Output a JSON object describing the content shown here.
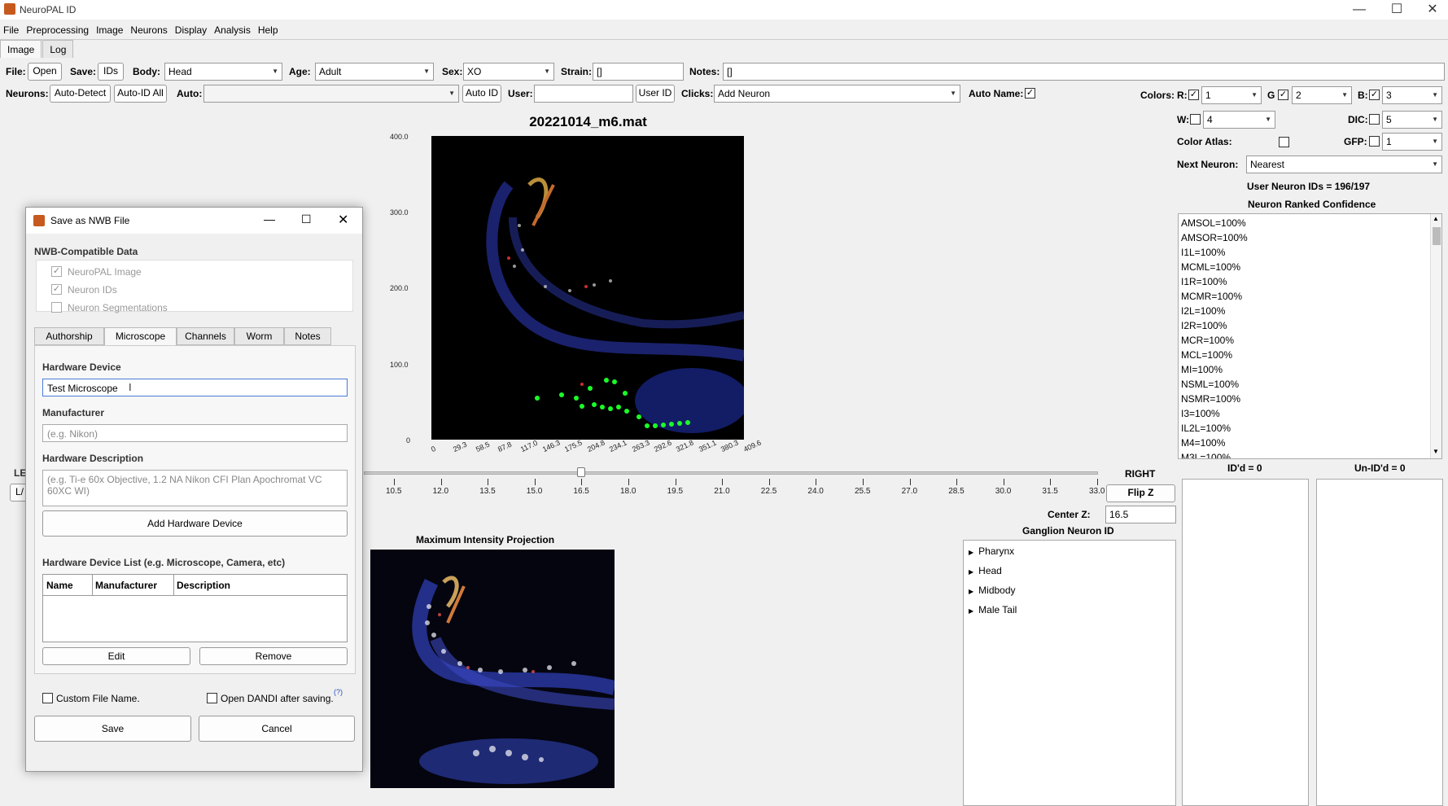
{
  "app": {
    "title": "NeuroPAL ID"
  },
  "menu": [
    "File",
    "Preprocessing",
    "Image",
    "Neurons",
    "Display",
    "Analysis",
    "Help"
  ],
  "main_tabs": [
    "Image",
    "Log"
  ],
  "toolbar1": {
    "file_label": "File:",
    "open_btn": "Open",
    "save_label": "Save:",
    "ids_btn": "IDs",
    "body_label": "Body:",
    "body_value": "Head",
    "age_label": "Age:",
    "age_value": "Adult",
    "sex_label": "Sex:",
    "sex_value": "XO",
    "strain_label": "Strain:",
    "strain_value": "[]",
    "notes_label": "Notes:",
    "notes_value": "[]"
  },
  "toolbar2": {
    "neurons_label": "Neurons:",
    "autodetect_btn": "Auto-Detect",
    "autoidall_btn": "Auto-ID All",
    "auto_label": "Auto:",
    "auto_value": "",
    "autoid_btn": "Auto ID",
    "user_label": "User:",
    "user_value": "",
    "userid_btn": "User ID",
    "clicks_label": "Clicks:",
    "clicks_value": "Add Neuron",
    "autoname_label": "Auto Name:"
  },
  "colors": {
    "label": "Colors:",
    "r_label": "R:",
    "r_value": "1",
    "g_label": "G",
    "g_value": "2",
    "b_label": "B:",
    "b_value": "3",
    "w_label": "W:",
    "w_value": "4",
    "dic_label": "DIC:",
    "dic_value": "5",
    "atlas_label": "Color Atlas:",
    "gfp_label": "GFP:",
    "gfp_value": "1",
    "next_label": "Next Neuron:",
    "next_value": "Nearest"
  },
  "stats": {
    "user_ids": "User Neuron IDs = 196/197",
    "ranked_title": "Neuron Ranked Confidence"
  },
  "ranked_list": [
    "AMSOL=100%",
    "AMSOR=100%",
    "I1L=100%",
    "MCML=100%",
    "I1R=100%",
    "MCMR=100%",
    "I2L=100%",
    "I2R=100%",
    "MCR=100%",
    "MCL=100%",
    "MI=100%",
    "NSML=100%",
    "NSMR=100%",
    "I3=100%",
    "IL2L=100%",
    "M4=100%",
    "M3L=100%"
  ],
  "plot": {
    "title": "20221014_m6.mat",
    "yticks": [
      "400.0",
      "300.0",
      "200.0",
      "100.0",
      "0"
    ],
    "xticks": [
      "0",
      "29.3",
      "58.5",
      "87.8",
      "117.0",
      "146.3",
      "175.5",
      "204.8",
      "234.1",
      "263.3",
      "292.6",
      "321.8",
      "351.1",
      "380.3",
      "409.6"
    ]
  },
  "zslider": {
    "ticks": [
      "10.5",
      "12.0",
      "13.5",
      "15.0",
      "16.5",
      "18.0",
      "19.5",
      "21.0",
      "22.5",
      "24.0",
      "25.5",
      "27.0",
      "28.5",
      "30.0",
      "31.5",
      "33.0"
    ],
    "right_label": "RIGHT",
    "flip_btn": "Flip Z",
    "centerz_label": "Center Z:",
    "centerz_value": "16.5",
    "left_partial": "LE",
    "left_btn": "L/"
  },
  "mip": {
    "title": "Maximum Intensity Projection"
  },
  "ganglion": {
    "title": "Ganglion Neuron ID",
    "items": [
      "Pharynx",
      "Head",
      "Midbody",
      "Male Tail"
    ]
  },
  "idd": {
    "ided": "ID'd = 0",
    "unided": "Un-ID'd = 0"
  },
  "dialog": {
    "title": "Save as NWB File",
    "section": "NWB-Compatible Data",
    "checks": [
      "NeuroPAL Image",
      "Neuron IDs",
      "Neuron Segmentations"
    ],
    "tabs": [
      "Authorship",
      "Microscope",
      "Channels",
      "Worm",
      "Notes"
    ],
    "hw_label": "Hardware Device",
    "hw_value": "Test Microscope",
    "mfr_label": "Manufacturer",
    "mfr_placeholder": "(e.g. Nikon)",
    "desc_label": "Hardware Description",
    "desc_placeholder": "(e.g. Ti-e 60x Objective, 1.2 NA Nikon CFI Plan Apochromat VC 60XC WI)",
    "add_btn": "Add Hardware Device",
    "list_label": "Hardware Device List (e.g. Microscope, Camera, etc)",
    "cols": [
      "Name",
      "Manufacturer",
      "Description"
    ],
    "edit_btn": "Edit",
    "remove_btn": "Remove",
    "custom_label": "Custom File Name.",
    "dandi_label": "Open DANDI after saving.",
    "dandi_help": "(?)",
    "save_btn": "Save",
    "cancel_btn": "Cancel"
  }
}
